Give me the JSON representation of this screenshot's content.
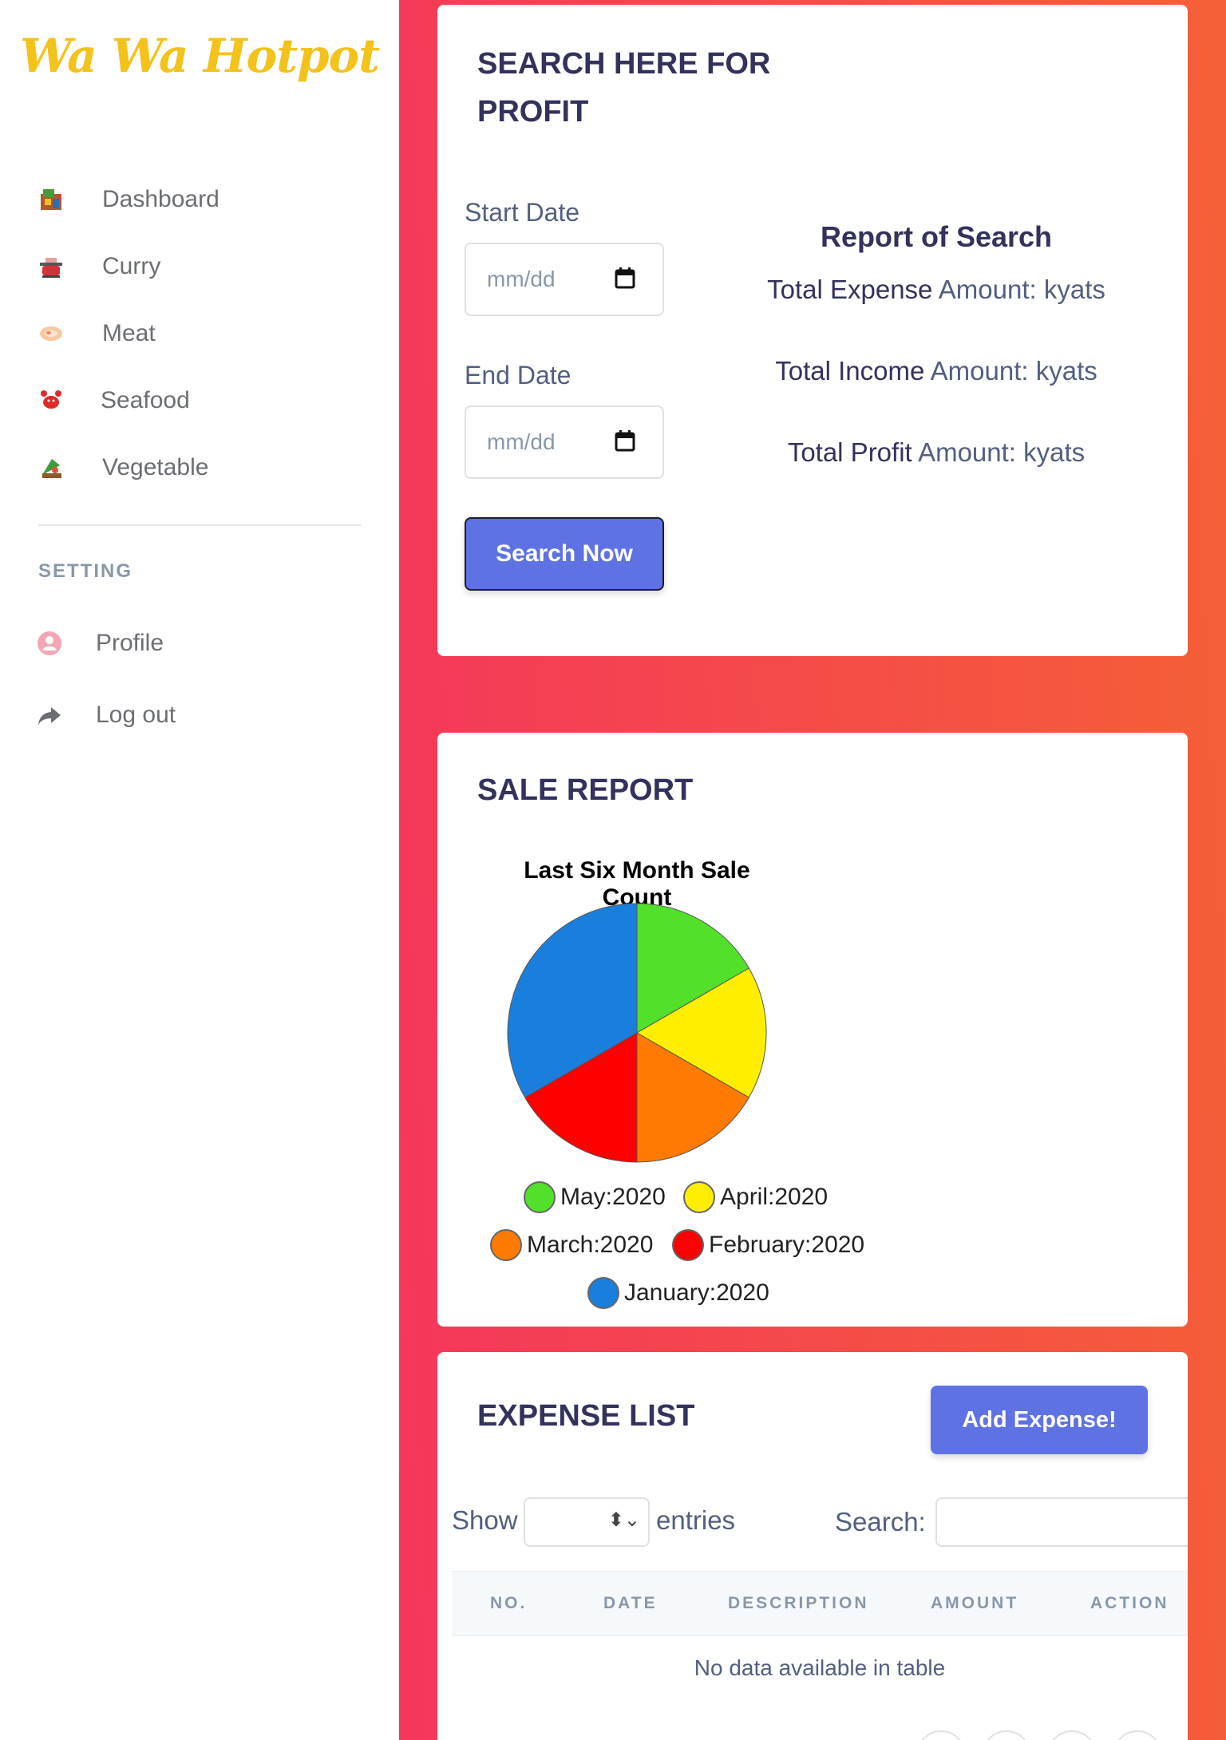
{
  "brand": {
    "name": "Wa Wa Hotpot"
  },
  "sidebar": {
    "items": [
      {
        "label": "Dashboard",
        "icon": "dashboard-icon"
      },
      {
        "label": "Curry",
        "icon": "curry-pot-icon"
      },
      {
        "label": "Meat",
        "icon": "meat-icon"
      },
      {
        "label": "Seafood",
        "icon": "crab-icon"
      },
      {
        "label": "Vegetable",
        "icon": "vegetable-icon"
      }
    ],
    "setting_heading": "SETTING",
    "setting_items": [
      {
        "label": "Profile",
        "icon": "user-icon"
      },
      {
        "label": "Log out",
        "icon": "share-arrow-icon"
      }
    ]
  },
  "search_card": {
    "title_line1": "SEARCH HERE FOR",
    "title_line2": "PROFIT",
    "start_label": "Start Date",
    "end_label": "End Date",
    "date_placeholder": "mm/dd",
    "button": "Search Now",
    "report": {
      "title": "Report of Search",
      "expense_label": "Total Expense",
      "income_label": "Total Income",
      "profit_label": "Total Profit",
      "amount_text": "Amount: kyats"
    }
  },
  "sale_card": {
    "title": "SALE REPORT"
  },
  "chart_data": {
    "type": "pie",
    "title": "Last Six Month Sale Count",
    "slices": [
      {
        "label": "May:2020",
        "value": 1,
        "color": "#52e02a"
      },
      {
        "label": "April:2020",
        "value": 1,
        "color": "#ffee00"
      },
      {
        "label": "March:2020",
        "value": 1,
        "color": "#ff7a00"
      },
      {
        "label": "February:2020",
        "value": 1,
        "color": "#ff0000"
      },
      {
        "label": "January:2020",
        "value": 2,
        "color": "#1a7fdc"
      }
    ],
    "legend": "bottom"
  },
  "expense_card": {
    "title": "EXPENSE LIST",
    "add_button": "Add Expense!",
    "show_label": "Show",
    "entries_label": "entries",
    "search_label": "Search:",
    "columns": [
      "NO.",
      "DATE",
      "DESCRIPTION",
      "AMOUNT",
      "ACTION"
    ],
    "empty_message": "No data available in table"
  },
  "colors": {
    "accent": "#5e72e4",
    "brand": "#f3c21b",
    "gradient_start": "#f5365c",
    "gradient_end": "#f56036"
  }
}
